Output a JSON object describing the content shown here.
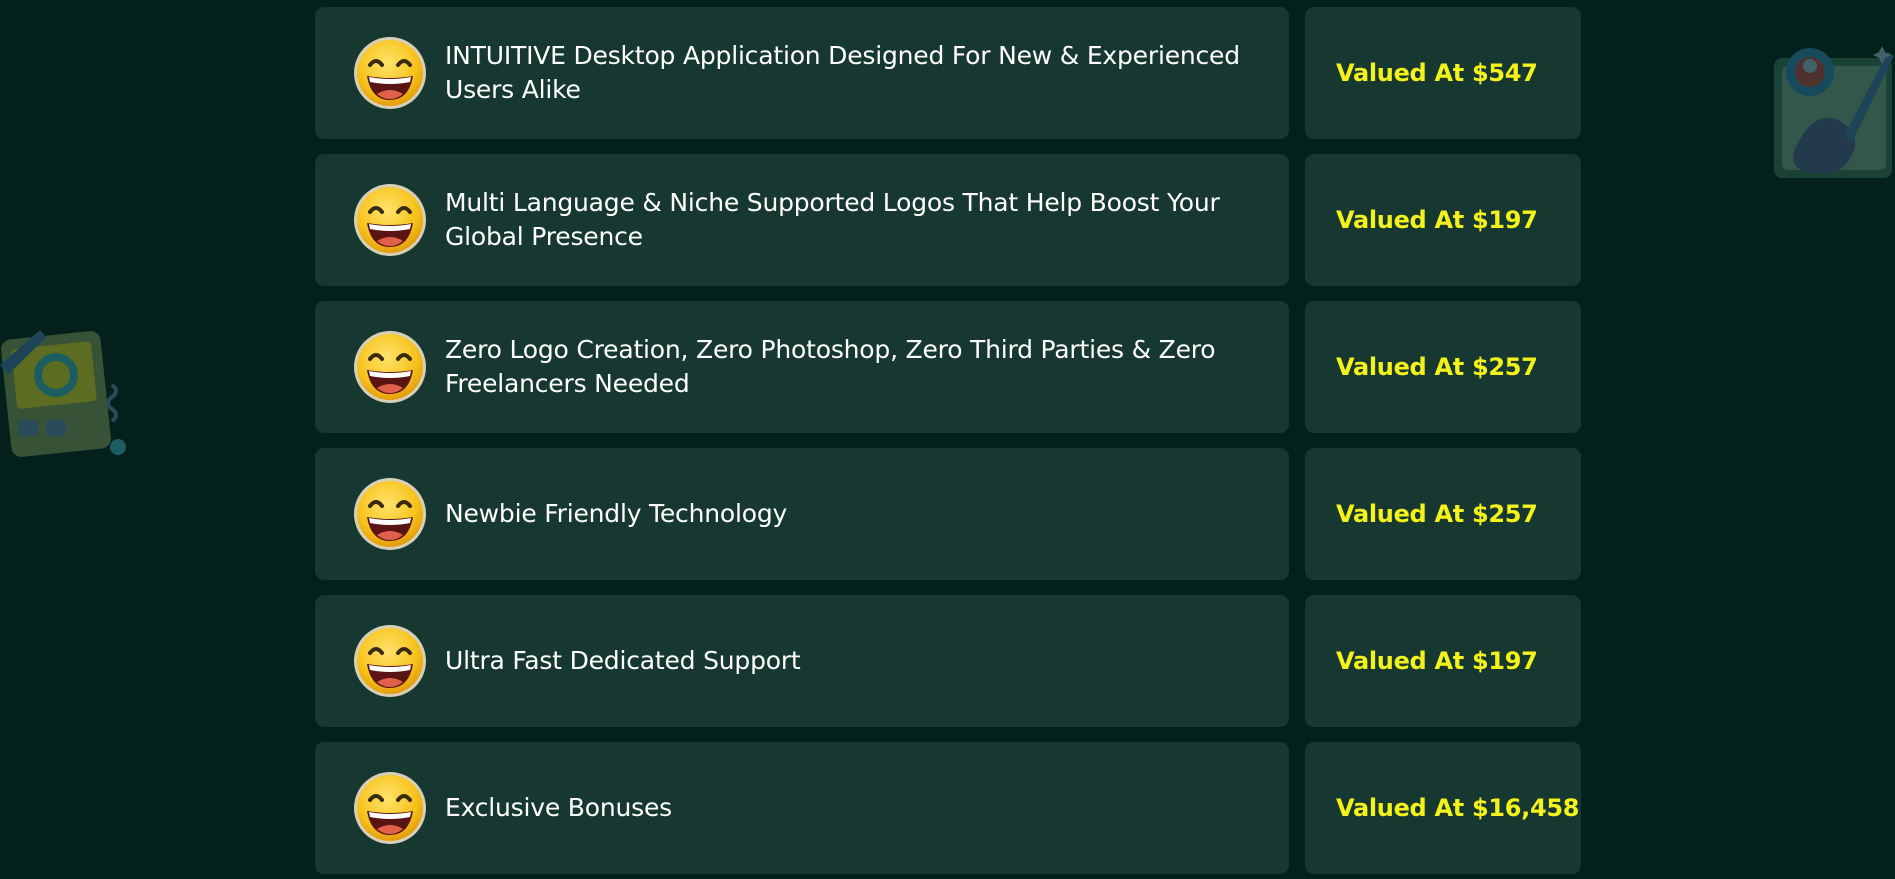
{
  "colors": {
    "background": "#03211a",
    "card": "#173831",
    "feature_text": "#ffffff",
    "value_text": "#f4f21b"
  },
  "decorations": {
    "left": "design-tablet-icon",
    "right": "paint-palette-icon"
  },
  "features": [
    {
      "icon": "grinning-face-emoji",
      "label": "INTUITIVE Desktop Application Designed For New & Experienced Users Alike",
      "value": "Valued At $547"
    },
    {
      "icon": "grinning-face-emoji",
      "label": "Multi Language & Niche Supported Logos That Help Boost Your Global Presence",
      "value": "Valued At $197"
    },
    {
      "icon": "grinning-face-emoji",
      "label": "Zero Logo Creation, Zero Photoshop, Zero Third Parties & Zero Freelancers Needed",
      "value": "Valued At $257"
    },
    {
      "icon": "grinning-face-emoji",
      "label": "Newbie Friendly Technology",
      "value": "Valued At $257"
    },
    {
      "icon": "grinning-face-emoji",
      "label": "Ultra Fast Dedicated Support",
      "value": "Valued At $197"
    },
    {
      "icon": "grinning-face-emoji",
      "label": "Exclusive Bonuses",
      "value": "Valued At $16,458"
    }
  ]
}
